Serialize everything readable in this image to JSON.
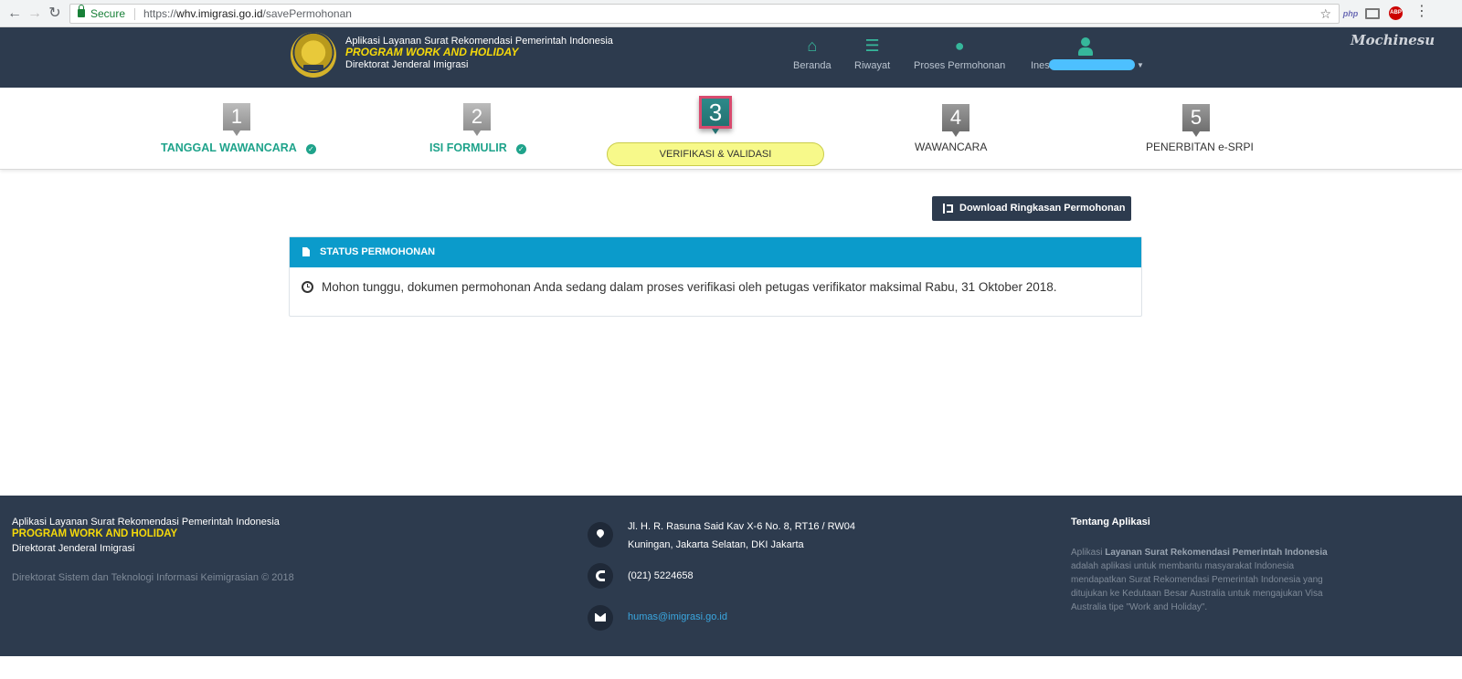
{
  "browser": {
    "back_icon": "arrow-left-icon",
    "forward_icon": "arrow-right-icon",
    "reload_icon": "reload-icon",
    "secure_label": "Secure",
    "url_prefix": "https://",
    "url_host": "whv.imigrasi.go.id",
    "url_path": "/savePermohonan",
    "extensions": [
      "php",
      "cast",
      "ABP"
    ]
  },
  "header": {
    "line1": "Aplikasi Layanan Surat Rekomendasi Pemerintah Indonesia",
    "line2": "PROGRAM WORK AND HOLIDAY",
    "line3": "Direktorat Jenderal Imigrasi",
    "nav": [
      {
        "label": "Beranda",
        "icon": "home-icon"
      },
      {
        "label": "Riwayat",
        "icon": "list-icon"
      },
      {
        "label": "Proses Permohonan",
        "icon": "map-pin-icon"
      }
    ],
    "user_name": "Ines",
    "watermark": "Mochinesu"
  },
  "steps": [
    {
      "number": "1",
      "label": "TANGGAL WAWANCARA",
      "state": "done"
    },
    {
      "number": "2",
      "label": "ISI FORMULIR",
      "state": "done"
    },
    {
      "number": "3",
      "label": "VERIFIKASI & VALIDASI",
      "state": "active"
    },
    {
      "number": "4",
      "label": "WAWANCARA",
      "state": "pending"
    },
    {
      "number": "5",
      "label": "PENERBITAN e-SRPI",
      "state": "pending"
    }
  ],
  "main": {
    "download_label": "Download Ringkasan Permohonan",
    "panel_title": "STATUS PERMOHONAN",
    "panel_message": "Mohon tunggu, dokumen permohonan Anda sedang dalam proses verifikasi oleh petugas verifikator maksimal Rabu, 31 Oktober 2018."
  },
  "footer": {
    "line1": "Aplikasi Layanan Surat Rekomendasi Pemerintah Indonesia",
    "line2": "PROGRAM WORK AND HOLIDAY",
    "line3": "Direktorat Jenderal Imigrasi",
    "copyright": "Direktorat Sistem dan Teknologi Informasi Keimigrasian © 2018",
    "address_line1": "Jl. H. R. Rasuna Said Kav X-6 No. 8, RT16 / RW04",
    "address_line2": "Kuningan, Jakarta Selatan, DKI Jakarta",
    "phone": "(021) 5224658",
    "email": "humas@imigrasi.go.id",
    "about_title": "Tentang Aplikasi",
    "about_prefix": "Aplikasi",
    "about_bold": "Layanan Surat Rekomendasi Pemerintah Indonesia",
    "about_rest": "adalah aplikasi untuk membantu masyarakat Indonesia mendapatkan Surat Rekomendasi Pemerintah Indonesia yang ditujukan ke Kedutaan Besar Australia untuk mengajukan Visa Australia tipe \"Work and Holiday\"."
  },
  "colors": {
    "header_bg": "#2d3b4e",
    "accent_teal": "#36b79b",
    "brand_yellow": "#f5d90a",
    "panel_blue": "#0b9bcb",
    "active_pill": "#f7f98a"
  }
}
